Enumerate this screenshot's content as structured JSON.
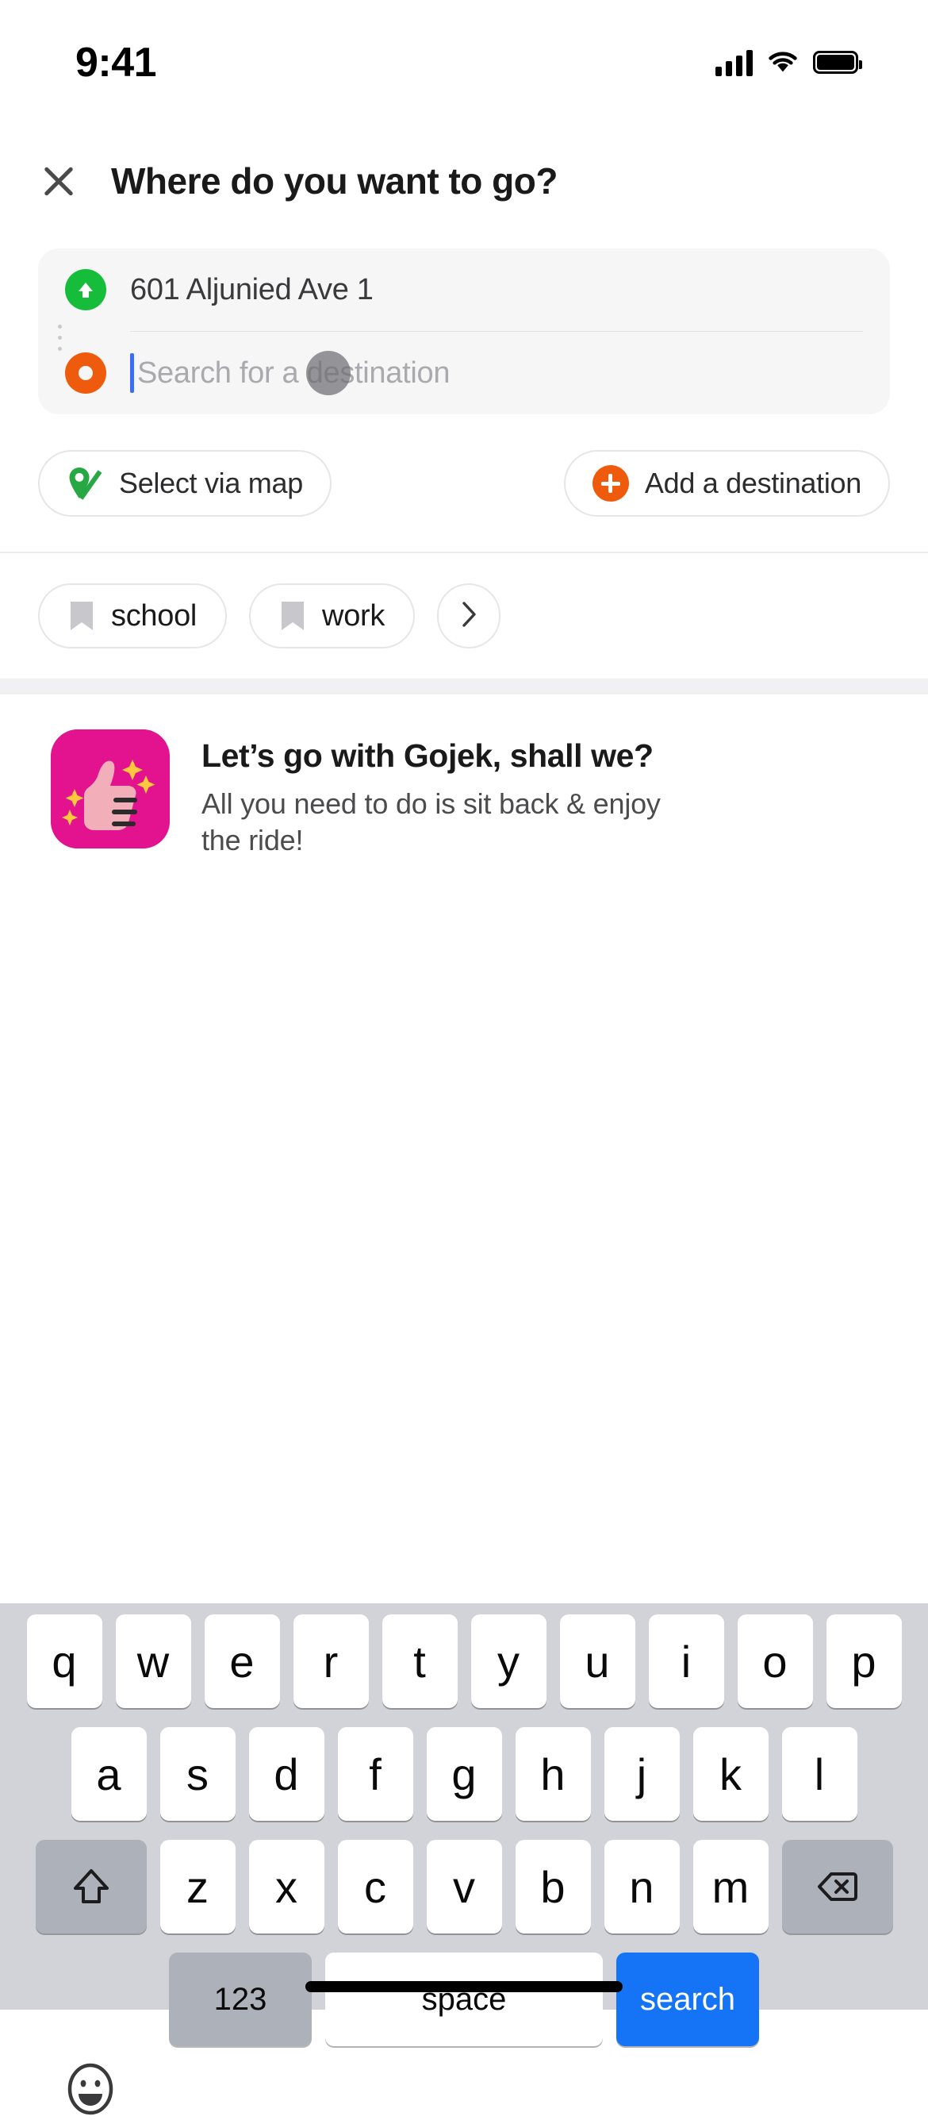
{
  "status_bar": {
    "time": "9:41",
    "cellular_icon": "cellular-signal-icon",
    "wifi_icon": "wifi-icon",
    "battery_icon": "battery-full-icon"
  },
  "header": {
    "close_icon": "close-icon",
    "title": "Where do you want to go?"
  },
  "search_card": {
    "origin": {
      "icon": "origin-up-arrow-icon",
      "icon_color": "#16bd3a",
      "value": "601 Aljunied Ave 1"
    },
    "destination": {
      "icon": "destination-dot-icon",
      "icon_color": "#ef5b0c",
      "value": "",
      "placeholder": "Search for a destination",
      "caret_color": "#3b6ef6"
    }
  },
  "actions": [
    {
      "name": "select-via-map",
      "icon": "map-pin-icon",
      "label": "Select via map"
    },
    {
      "name": "add-a-destination",
      "icon": "plus-circle-icon",
      "label": "Add a destination"
    }
  ],
  "shortcuts": {
    "items": [
      {
        "icon": "bookmark-icon",
        "label": "school"
      },
      {
        "icon": "bookmark-icon",
        "label": "work"
      }
    ],
    "more_icon": "chevron-right-icon"
  },
  "promo": {
    "image": "thumbs-up-sparkle-icon",
    "image_bg": "#e3128e",
    "title": "Let’s go with Gojek, shall we?",
    "subtitle": "All you need to do is sit back & enjoy the ride!"
  },
  "keyboard": {
    "row1": [
      "q",
      "w",
      "e",
      "r",
      "t",
      "y",
      "u",
      "i",
      "o",
      "p"
    ],
    "row2": [
      "a",
      "s",
      "d",
      "f",
      "g",
      "h",
      "j",
      "k",
      "l"
    ],
    "row3": [
      "z",
      "x",
      "c",
      "v",
      "b",
      "n",
      "m"
    ],
    "shift_icon": "shift-icon",
    "backspace_icon": "backspace-icon",
    "numbers_label": "123",
    "space_label": "space",
    "return_label": "search",
    "emoji_icon": "emoji-smiley-icon",
    "return_color": "#1574f5"
  },
  "home_indicator": "home-indicator"
}
